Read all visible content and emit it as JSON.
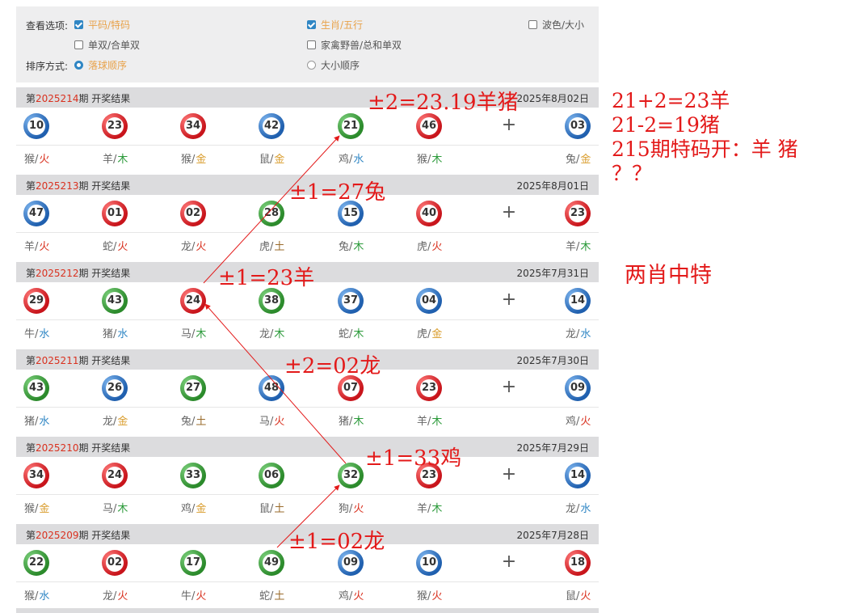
{
  "options": {
    "view_label": "查看选项:",
    "sort_label": "排序方式:",
    "checks": [
      {
        "label": "平码/特码",
        "checked": true
      },
      {
        "label": "生肖/五行",
        "checked": true
      },
      {
        "label": "波色/大小",
        "checked": false
      },
      {
        "label": "单双/合单双",
        "checked": false
      },
      {
        "label": "家禽野兽/总和单双",
        "checked": false
      }
    ],
    "sorts": [
      {
        "label": "落球顺序",
        "selected": true
      },
      {
        "label": "大小顺序",
        "selected": false
      }
    ]
  },
  "draws": [
    {
      "prefix": "第",
      "no": "2025214",
      "suffix": "期 开奖结果",
      "date": "2025年8月02日",
      "balls": [
        {
          "n": "10",
          "c": "blue"
        },
        {
          "n": "23",
          "c": "red"
        },
        {
          "n": "34",
          "c": "red"
        },
        {
          "n": "42",
          "c": "blue"
        },
        {
          "n": "21",
          "c": "green"
        },
        {
          "n": "46",
          "c": "red"
        },
        {
          "n": "03",
          "c": "blue"
        }
      ],
      "zodiac": [
        {
          "z": "猴",
          "e": "火",
          "t": "fire"
        },
        {
          "z": "羊",
          "e": "木",
          "t": "wood"
        },
        {
          "z": "猴",
          "e": "金",
          "t": "metal"
        },
        {
          "z": "鼠",
          "e": "金",
          "t": "metal"
        },
        {
          "z": "鸡",
          "e": "水",
          "t": "water"
        },
        {
          "z": "猴",
          "e": "木",
          "t": "wood"
        },
        {
          "z": "兔",
          "e": "金",
          "t": "metal"
        }
      ]
    },
    {
      "prefix": "第",
      "no": "2025213",
      "suffix": "期 开奖结果",
      "date": "2025年8月01日",
      "balls": [
        {
          "n": "47",
          "c": "blue"
        },
        {
          "n": "01",
          "c": "red"
        },
        {
          "n": "02",
          "c": "red"
        },
        {
          "n": "28",
          "c": "green"
        },
        {
          "n": "15",
          "c": "blue"
        },
        {
          "n": "40",
          "c": "red"
        },
        {
          "n": "23",
          "c": "red"
        }
      ],
      "zodiac": [
        {
          "z": "羊",
          "e": "火",
          "t": "fire"
        },
        {
          "z": "蛇",
          "e": "火",
          "t": "fire"
        },
        {
          "z": "龙",
          "e": "火",
          "t": "fire"
        },
        {
          "z": "虎",
          "e": "土",
          "t": "earth"
        },
        {
          "z": "兔",
          "e": "木",
          "t": "wood"
        },
        {
          "z": "虎",
          "e": "火",
          "t": "fire"
        },
        {
          "z": "羊",
          "e": "木",
          "t": "wood"
        }
      ]
    },
    {
      "prefix": "第",
      "no": "2025212",
      "suffix": "期 开奖结果",
      "date": "2025年7月31日",
      "balls": [
        {
          "n": "29",
          "c": "red"
        },
        {
          "n": "43",
          "c": "green"
        },
        {
          "n": "24",
          "c": "red"
        },
        {
          "n": "38",
          "c": "green"
        },
        {
          "n": "37",
          "c": "blue"
        },
        {
          "n": "04",
          "c": "blue"
        },
        {
          "n": "14",
          "c": "blue"
        }
      ],
      "zodiac": [
        {
          "z": "牛",
          "e": "水",
          "t": "water"
        },
        {
          "z": "猪",
          "e": "水",
          "t": "water"
        },
        {
          "z": "马",
          "e": "木",
          "t": "wood"
        },
        {
          "z": "龙",
          "e": "木",
          "t": "wood"
        },
        {
          "z": "蛇",
          "e": "木",
          "t": "wood"
        },
        {
          "z": "虎",
          "e": "金",
          "t": "metal"
        },
        {
          "z": "龙",
          "e": "水",
          "t": "water"
        }
      ]
    },
    {
      "prefix": "第",
      "no": "2025211",
      "suffix": "期 开奖结果",
      "date": "2025年7月30日",
      "balls": [
        {
          "n": "43",
          "c": "green"
        },
        {
          "n": "26",
          "c": "blue"
        },
        {
          "n": "27",
          "c": "green"
        },
        {
          "n": "48",
          "c": "blue"
        },
        {
          "n": "07",
          "c": "red"
        },
        {
          "n": "23",
          "c": "red"
        },
        {
          "n": "09",
          "c": "blue"
        }
      ],
      "zodiac": [
        {
          "z": "猪",
          "e": "水",
          "t": "water"
        },
        {
          "z": "龙",
          "e": "金",
          "t": "metal"
        },
        {
          "z": "兔",
          "e": "土",
          "t": "earth"
        },
        {
          "z": "马",
          "e": "火",
          "t": "fire"
        },
        {
          "z": "猪",
          "e": "木",
          "t": "wood"
        },
        {
          "z": "羊",
          "e": "木",
          "t": "wood"
        },
        {
          "z": "鸡",
          "e": "火",
          "t": "fire"
        }
      ]
    },
    {
      "prefix": "第",
      "no": "2025210",
      "suffix": "期 开奖结果",
      "date": "2025年7月29日",
      "balls": [
        {
          "n": "34",
          "c": "red"
        },
        {
          "n": "24",
          "c": "red"
        },
        {
          "n": "33",
          "c": "green"
        },
        {
          "n": "06",
          "c": "green"
        },
        {
          "n": "32",
          "c": "green"
        },
        {
          "n": "23",
          "c": "red"
        },
        {
          "n": "14",
          "c": "blue"
        }
      ],
      "zodiac": [
        {
          "z": "猴",
          "e": "金",
          "t": "metal"
        },
        {
          "z": "马",
          "e": "木",
          "t": "wood"
        },
        {
          "z": "鸡",
          "e": "金",
          "t": "metal"
        },
        {
          "z": "鼠",
          "e": "土",
          "t": "earth"
        },
        {
          "z": "狗",
          "e": "火",
          "t": "fire"
        },
        {
          "z": "羊",
          "e": "木",
          "t": "wood"
        },
        {
          "z": "龙",
          "e": "水",
          "t": "water"
        }
      ]
    },
    {
      "prefix": "第",
      "no": "2025209",
      "suffix": "期 开奖结果",
      "date": "2025年7月28日",
      "balls": [
        {
          "n": "22",
          "c": "green"
        },
        {
          "n": "02",
          "c": "red"
        },
        {
          "n": "17",
          "c": "green"
        },
        {
          "n": "49",
          "c": "green"
        },
        {
          "n": "09",
          "c": "blue"
        },
        {
          "n": "10",
          "c": "blue"
        },
        {
          "n": "18",
          "c": "red"
        }
      ],
      "zodiac": [
        {
          "z": "猴",
          "e": "水",
          "t": "water"
        },
        {
          "z": "龙",
          "e": "火",
          "t": "fire"
        },
        {
          "z": "牛",
          "e": "火",
          "t": "fire"
        },
        {
          "z": "蛇",
          "e": "土",
          "t": "earth"
        },
        {
          "z": "鸡",
          "e": "火",
          "t": "fire"
        },
        {
          "z": "猴",
          "e": "火",
          "t": "fire"
        },
        {
          "z": "鼠",
          "e": "火",
          "t": "fire"
        }
      ]
    }
  ],
  "plus_sign": "+",
  "annotations": {
    "a1": "±2=23.19羊猪",
    "a2": "±1=27兔",
    "a3": "±1=23羊",
    "a4": "±2=02龙",
    "a5": "±1=33鸡",
    "a6": "±1=02龙"
  },
  "notes": {
    "line1": "21+2=23羊",
    "line2": "21-2=19猪",
    "line3": "215期特码开：羊 猪",
    "line4": "？？",
    "side": "两肖中特"
  },
  "colors": {
    "red": "#d9311f",
    "annotation": "#e31a1a",
    "accent": "#2f86c4"
  }
}
